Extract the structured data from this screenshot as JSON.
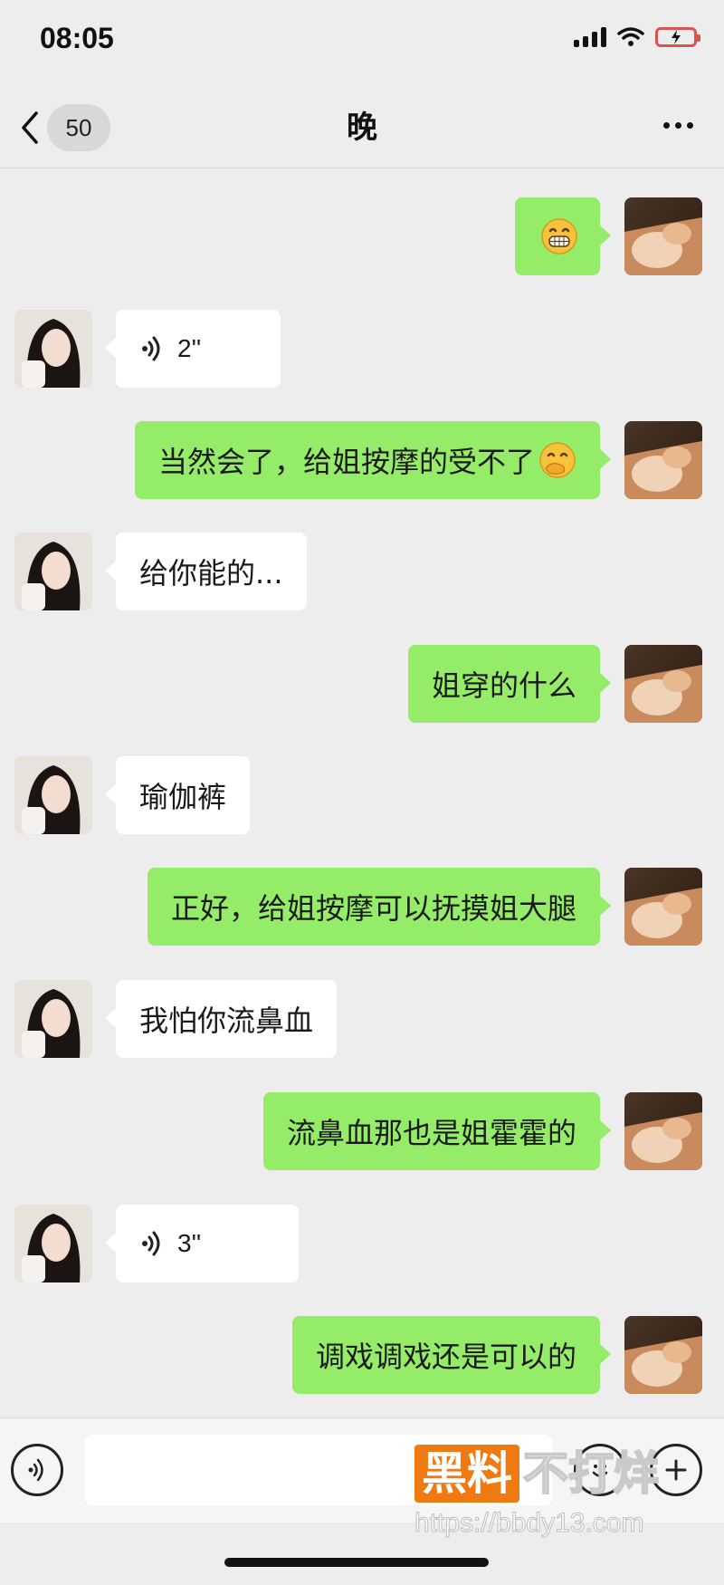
{
  "status_bar": {
    "time": "08:05"
  },
  "header": {
    "back_icon": "chevron-left-icon",
    "unread_count": "50",
    "title": "晚",
    "more_icon": "ellipsis-icon"
  },
  "messages": [
    {
      "sender": "me",
      "type": "emoji",
      "emoji": "grinning-face-emoji"
    },
    {
      "sender": "them",
      "type": "voice",
      "duration": "2''"
    },
    {
      "sender": "me",
      "type": "text",
      "text": "当然会了，给姐按摩的受不了",
      "emoji": "hand-over-mouth-emoji"
    },
    {
      "sender": "them",
      "type": "text",
      "text": "给你能的..."
    },
    {
      "sender": "me",
      "type": "text",
      "text": "姐穿的什么"
    },
    {
      "sender": "them",
      "type": "text",
      "text": "瑜伽裤"
    },
    {
      "sender": "me",
      "type": "text",
      "text": "正好，给姐按摩可以抚摸姐大腿"
    },
    {
      "sender": "them",
      "type": "text",
      "text": "我怕你流鼻血"
    },
    {
      "sender": "me",
      "type": "text",
      "text": "流鼻血那也是姐霍霍的"
    },
    {
      "sender": "them",
      "type": "voice",
      "duration": "3''"
    },
    {
      "sender": "me",
      "type": "text",
      "text": "调戏调戏还是可以的"
    }
  ],
  "input_bar": {
    "voice_icon": "voice-mode-icon",
    "input_value": "",
    "emoji_icon": "emoji-icon",
    "plus_icon": "plus-icon"
  },
  "watermark": {
    "brand_highlight": "黑料",
    "brand_rest": "不打烊",
    "url": "https://bbdy13.com"
  },
  "colors": {
    "background": "#ededed",
    "my_bubble": "#95ec69",
    "their_bubble": "#ffffff",
    "watermark_accent": "#f07a12"
  }
}
